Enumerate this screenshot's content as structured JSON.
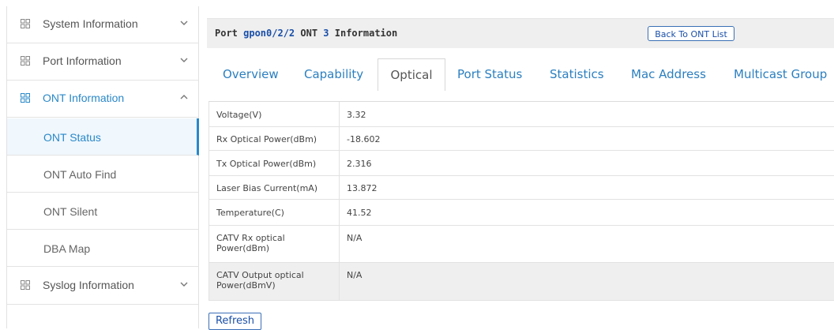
{
  "sidebar": {
    "groups": [
      {
        "label": "System Information",
        "icon": "grid-icon",
        "chevron": "chevron-down"
      },
      {
        "label": "Port Information",
        "icon": "grid-icon",
        "chevron": "chevron-down"
      },
      {
        "label": "ONT Information",
        "icon": "grid-icon",
        "chevron": "chevron-up"
      },
      {
        "label": "Syslog Information",
        "icon": "grid-icon",
        "chevron": "chevron-down"
      }
    ],
    "ont_items": [
      {
        "label": "ONT Status"
      },
      {
        "label": "ONT Auto Find"
      },
      {
        "label": "ONT Silent"
      },
      {
        "label": "DBA Map"
      }
    ]
  },
  "header": {
    "port_prefix": "Port ",
    "port": "gpon0/2/2",
    "ont_text": " ONT ",
    "ont_id": "3",
    "suffix": " Information",
    "back_button": "Back To ONT List"
  },
  "tabs": [
    "Overview",
    "Capability",
    "Optical",
    "Port Status",
    "Statistics",
    "Mac Address",
    "Multicast Group"
  ],
  "active_tab": "Optical",
  "optical": {
    "rows": [
      {
        "label": "Voltage(V)",
        "value": "3.32"
      },
      {
        "label": "Rx Optical Power(dBm)",
        "value": "-18.602"
      },
      {
        "label": "Tx Optical Power(dBm)",
        "value": "2.316"
      },
      {
        "label": "Laser Bias Current(mA)",
        "value": "13.872"
      },
      {
        "label": "Temperature(C)",
        "value": "41.52"
      },
      {
        "label": "CATV Rx optical Power(dBm)",
        "value": "N/A"
      },
      {
        "label": "CATV Output optical Power(dBmV)",
        "value": "N/A"
      }
    ]
  },
  "refresh_button": "Refresh",
  "colors": {
    "accent": "#2a88c8",
    "link": "#1a4fa8",
    "header_bg": "#efefef"
  }
}
